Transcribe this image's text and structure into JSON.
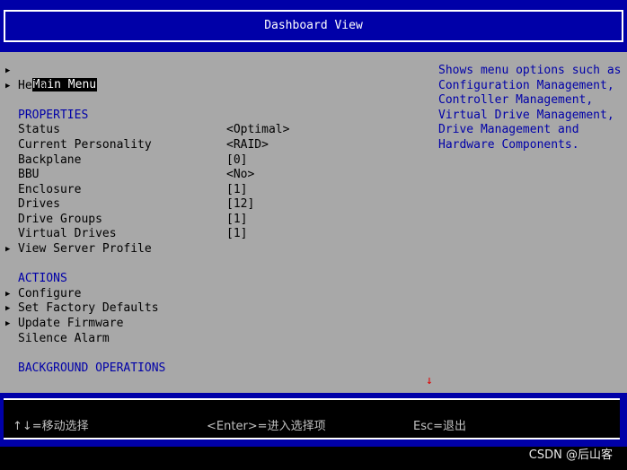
{
  "header": {
    "title": "Dashboard View"
  },
  "menu": {
    "main_menu": "Main Menu",
    "help": "Help"
  },
  "properties": {
    "heading": "PROPERTIES",
    "rows": [
      {
        "label": "Status",
        "value": "<Optimal>"
      },
      {
        "label": "Current Personality",
        "value": "<RAID>"
      },
      {
        "label": "Backplane",
        "value": "[0]"
      },
      {
        "label": "BBU",
        "value": "<No>"
      },
      {
        "label": "Enclosure",
        "value": "[1]"
      },
      {
        "label": "Drives",
        "value": "[12]"
      },
      {
        "label": "Drive Groups",
        "value": "[1]"
      },
      {
        "label": "Virtual Drives",
        "value": "[1]"
      }
    ],
    "view_server_profile": "View Server Profile"
  },
  "actions": {
    "heading": "ACTIONS",
    "configure": "Configure",
    "set_factory_defaults": "Set Factory Defaults",
    "update_firmware": "Update Firmware",
    "silence_alarm": "Silence Alarm"
  },
  "background_operations": {
    "heading": "BACKGROUND OPERATIONS"
  },
  "help_panel": {
    "lines": [
      "Shows menu options such as",
      "Configuration Management,",
      "Controller Management,",
      "Virtual Drive Management,",
      "Drive Management and",
      "Hardware Components."
    ]
  },
  "status_bar": {
    "move": "↑↓=移动选择",
    "enter": "<Enter>=进入选择项",
    "esc": "Esc=退出"
  },
  "indicator": {
    "red_arrow": "↓"
  },
  "watermark": "CSDN @后山客",
  "colors": {
    "bios_blue": "#0000a8",
    "bios_gray": "#a8a8a8",
    "selection_bg": "#000000",
    "indicator_red": "#e00000"
  }
}
